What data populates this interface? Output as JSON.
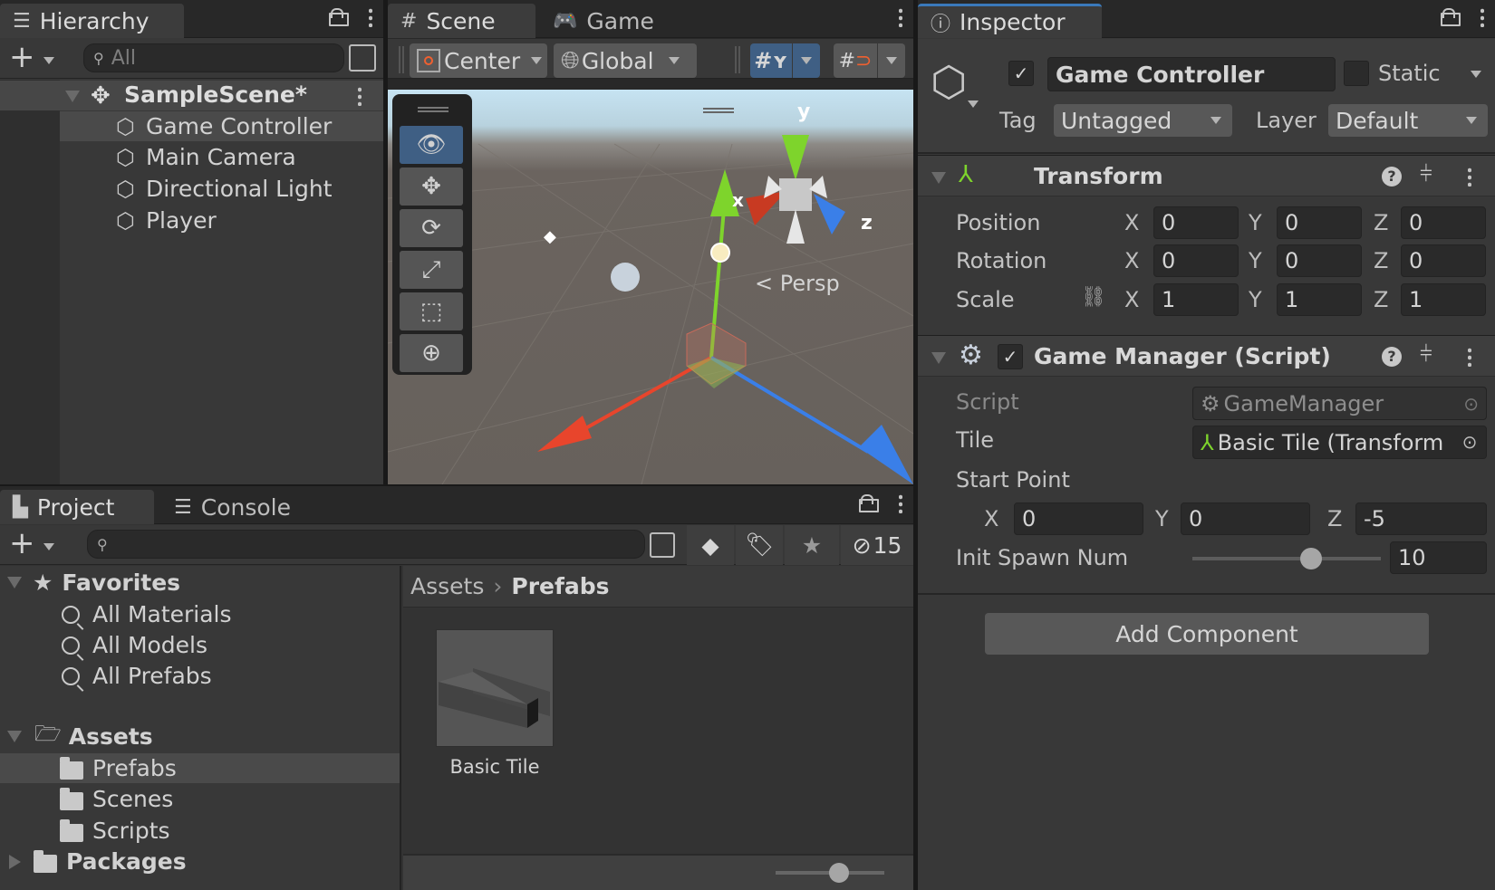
{
  "hierarchy": {
    "tab_label": "Hierarchy",
    "search_placeholder": "All",
    "scene_name": "SampleScene*",
    "items": [
      {
        "label": "Game Controller",
        "selected": true
      },
      {
        "label": "Main Camera",
        "selected": false
      },
      {
        "label": "Directional Light",
        "selected": false
      },
      {
        "label": "Player",
        "selected": false
      }
    ]
  },
  "scene": {
    "tabs": [
      {
        "label": "Scene",
        "active": true
      },
      {
        "label": "Game",
        "active": false
      }
    ],
    "pivot_mode": "Center",
    "pivot_rotation": "Global",
    "projection_label": "Persp",
    "gizmo_axes": {
      "x": "x",
      "y": "y",
      "z": "z"
    },
    "tools": [
      "view-tool",
      "move-tool",
      "rotate-tool",
      "scale-tool",
      "rect-tool",
      "transform-tool"
    ],
    "active_tool": "view-tool",
    "colors": {
      "x_axis": "#e8452c",
      "y_axis": "#7ed42c",
      "z_axis": "#3a7fe8",
      "active_blue": "#3f5f84"
    }
  },
  "project": {
    "tabs": [
      {
        "label": "Project",
        "active": true
      },
      {
        "label": "Console",
        "active": false
      }
    ],
    "search_value": "",
    "hidden_count": "15",
    "favorites": {
      "label": "Favorites",
      "items": [
        "All Materials",
        "All Models",
        "All Prefabs"
      ]
    },
    "assets": {
      "label": "Assets",
      "items": [
        {
          "label": "Prefabs",
          "selected": true
        },
        {
          "label": "Scenes",
          "selected": false
        },
        {
          "label": "Scripts",
          "selected": false
        }
      ]
    },
    "packages_label": "Packages",
    "breadcrumb": [
      "Assets",
      "Prefabs"
    ],
    "files": [
      {
        "label": "Basic Tile"
      }
    ],
    "thumbnail_zoom": 0.58
  },
  "inspector": {
    "tab_label": "Inspector",
    "object_name": "Game Controller",
    "active": true,
    "static_label": "Static",
    "static": false,
    "tag_label": "Tag",
    "tag_value": "Untagged",
    "layer_label": "Layer",
    "layer_value": "Default",
    "transform": {
      "title": "Transform",
      "rows": [
        {
          "label": "Position",
          "x": "0",
          "y": "0",
          "z": "0"
        },
        {
          "label": "Rotation",
          "x": "0",
          "y": "0",
          "z": "0"
        },
        {
          "label": "Scale",
          "x": "1",
          "y": "1",
          "z": "1"
        }
      ]
    },
    "game_manager": {
      "title": "Game Manager (Script)",
      "enabled": true,
      "script_label": "Script",
      "script_value": "GameManager",
      "tile_label": "Tile",
      "tile_value": "Basic Tile (Transform",
      "start_point_label": "Start Point",
      "start_point": {
        "x": "0",
        "y": "0",
        "z": "-5"
      },
      "init_spawn_label": "Init Spawn Num",
      "init_spawn_value": "10",
      "init_spawn_slider_fraction": 0.63
    },
    "add_component_label": "Add Component",
    "axis_labels": {
      "x": "X",
      "y": "Y",
      "z": "Z"
    }
  }
}
